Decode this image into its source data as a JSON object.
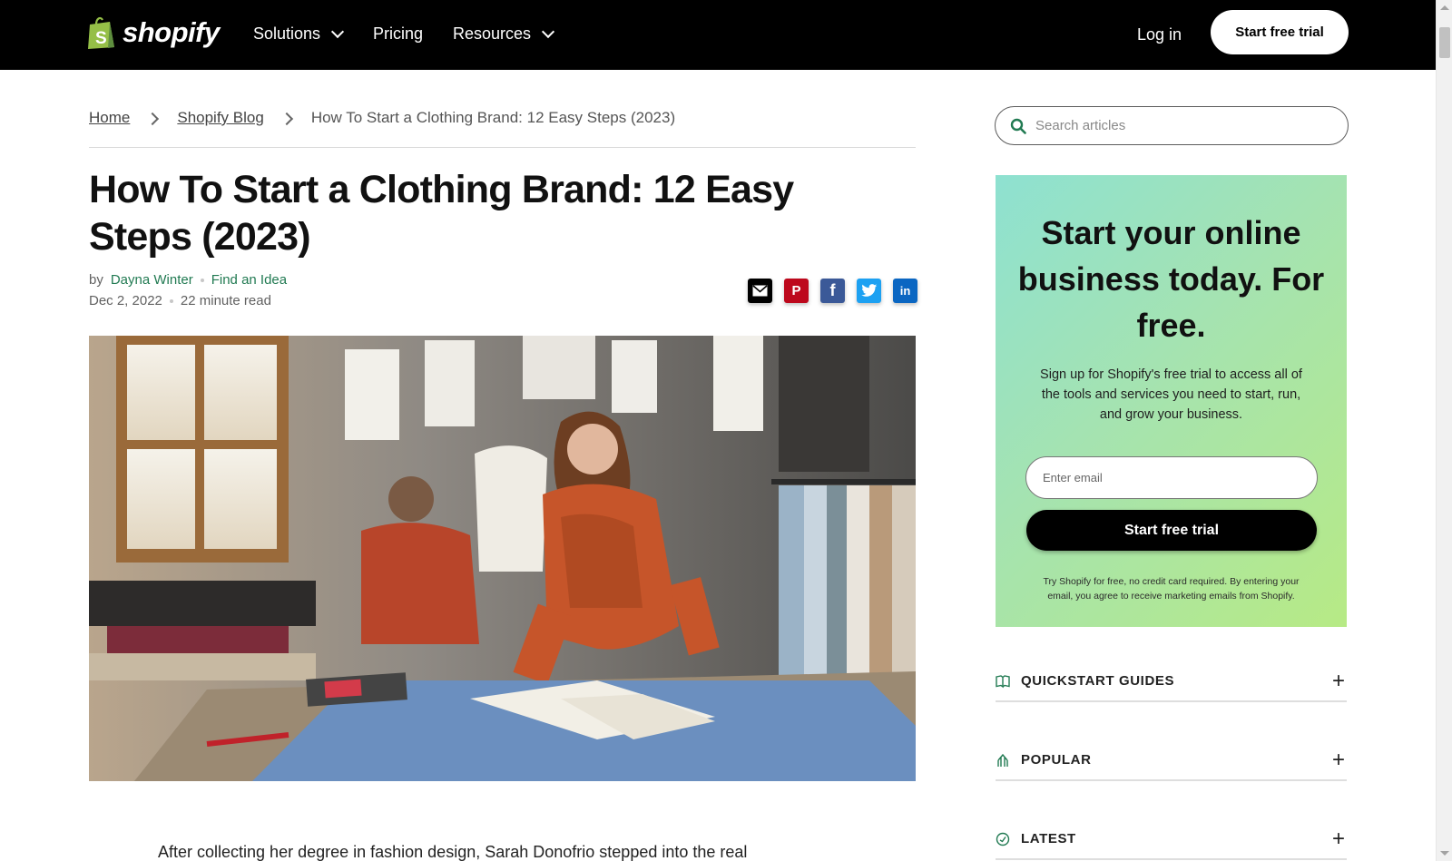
{
  "nav": {
    "logo_text": "shopify",
    "items": [
      {
        "label": "Solutions",
        "has_dropdown": true
      },
      {
        "label": "Pricing",
        "has_dropdown": false
      },
      {
        "label": "Resources",
        "has_dropdown": true
      }
    ],
    "login": "Log in",
    "cta": "Start free trial"
  },
  "breadcrumb": {
    "home": "Home",
    "blog": "Shopify Blog",
    "current": "How To Start a Clothing Brand: 12 Easy Steps (2023)"
  },
  "article": {
    "title": "How To Start a Clothing Brand: 12 Easy Steps (2023)",
    "by": "by",
    "author": "Dayna Winter",
    "category": "Find an Idea",
    "date": "Dec 2, 2022",
    "read_time": "22 minute read",
    "first_line": "After collecting her degree in fashion design, Sarah Donofrio stepped into the real"
  },
  "share": [
    {
      "name": "email-icon",
      "color": "#000000"
    },
    {
      "name": "pinterest-icon",
      "color": "#bd081c",
      "glyph": "P"
    },
    {
      "name": "facebook-icon",
      "color": "#3b5998",
      "glyph": "f"
    },
    {
      "name": "twitter-icon",
      "color": "#1da1f2"
    },
    {
      "name": "linkedin-icon",
      "color": "#0a66c2",
      "glyph": "in"
    }
  ],
  "search": {
    "placeholder": "Search articles"
  },
  "promo": {
    "title": "Start your online business today. For free.",
    "description": "Sign up for Shopify's free trial to access all of the tools and services you need to start, run, and grow your business.",
    "email_placeholder": "Enter email",
    "button": "Start free trial",
    "fine_print": "Try Shopify for free, no credit card required. By entering your email, you agree to receive marketing emails from Shopify."
  },
  "accordion": [
    {
      "label": "QUICKSTART GUIDES",
      "icon": "book-icon"
    },
    {
      "label": "POPULAR",
      "icon": "trending-icon"
    },
    {
      "label": "LATEST",
      "icon": "clock-icon"
    }
  ],
  "colors": {
    "brand_green": "#217a52",
    "nav_bg": "#000000"
  }
}
